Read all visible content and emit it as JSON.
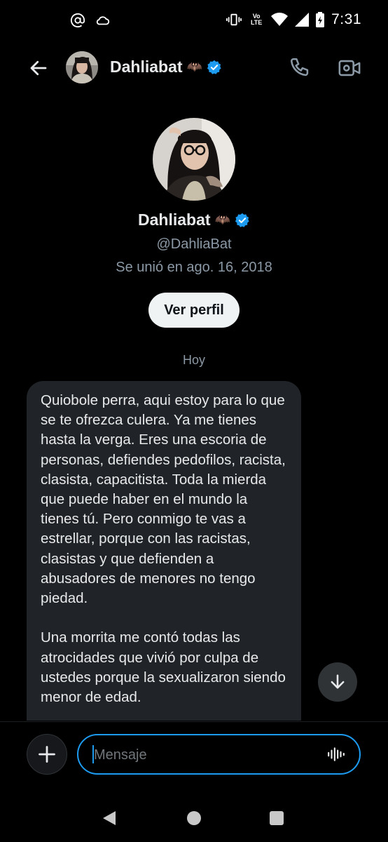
{
  "status_bar": {
    "time": "7:31",
    "volte_line1": "Vo",
    "volte_line2": "LTE",
    "icons": [
      "at-sign-icon",
      "cloud-sync-icon",
      "vibrate-icon",
      "volte-icon",
      "wifi-icon",
      "signal-icon",
      "battery-charging-icon"
    ]
  },
  "header": {
    "name": "Dahliabat",
    "emoji": "🦇",
    "verified": true,
    "icons": [
      "back-arrow-icon",
      "phone-icon",
      "video-icon"
    ]
  },
  "profile": {
    "name": "Dahliabat",
    "emoji": "🦇",
    "handle": "@DahliaBat",
    "joined": "Se unió en ago. 16, 2018",
    "view_profile_label": "Ver perfil"
  },
  "date_separator": "Hoy",
  "messages": [
    {
      "direction": "incoming",
      "text": "Quiobole perra, aqui estoy para lo que se te ofrezca culera. Ya me tienes hasta la verga. Eres una escoria de personas, defiendes pedofilos, racista, clasista, capacitista. Toda la mierda que puede haber en el mundo la tienes tú. Pero conmigo te vas a estrellar, porque con las racistas, clasistas y que defienden a abusadores de menores no tengo piedad.\n\nUna morrita me contó todas las atrocidades que vivió por culpa de ustedes porque la sexualizaron siendo menor de edad."
    }
  ],
  "composer": {
    "placeholder": "Mensaje",
    "value": ""
  },
  "colors": {
    "background": "#000000",
    "bubble": "#202327",
    "accent": "#1d9bf0",
    "secondary_text": "#8b98a5"
  }
}
